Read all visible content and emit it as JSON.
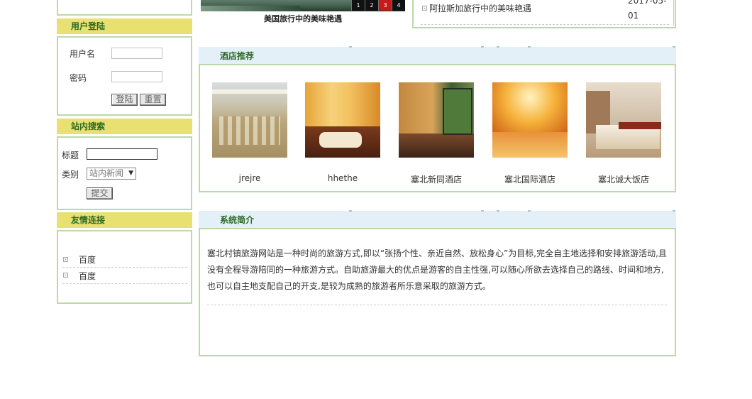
{
  "banner": {
    "caption": "美国旅行中的美味艳遇",
    "pages": [
      "1",
      "2",
      "3",
      "4"
    ],
    "active_page": 3
  },
  "news": {
    "item_title": "阿拉斯加旅行中的美味艳遇",
    "item_date_line1": "2017-05-",
    "item_date_line2": "01"
  },
  "login": {
    "header": "用户登陆",
    "username_label": "用户名",
    "password_label": "密码",
    "login_button": "登陆",
    "reset_button": "重置"
  },
  "search": {
    "header": "站内搜索",
    "title_label": "标题",
    "category_label": "类别",
    "category_selected": "站内新闻",
    "submit_button": "提交"
  },
  "links": {
    "header": "友情连接",
    "items": [
      "百度",
      "百度"
    ]
  },
  "hotels": {
    "header": "酒店推荐",
    "items": [
      {
        "name": "jrejre",
        "img": "hotel-lobby-image"
      },
      {
        "name": "hhethe",
        "img": "hotel-restaurant-image"
      },
      {
        "name": "塞北新同酒店",
        "img": "hotel-dining-room-image"
      },
      {
        "name": "塞北国际酒店",
        "img": "hotel-hallway-image"
      },
      {
        "name": "塞北诚大饭店",
        "img": "hotel-bedroom-image"
      }
    ]
  },
  "about": {
    "header": "系统简介",
    "text": "塞北村镇旅游网站是一种时尚的旅游方式,即以“张扬个性、亲近自然、放松身心”为目标,完全自主地选择和安排旅游活动,且没有全程导游陪同的一种旅游方式。自助旅游最大的优点是游客的自主性强,可以随心所欲去选择自己的路线、时间和地方,也可以自主地支配自己的开支,是较为成熟的旅游者所乐意采取的旅游方式。"
  },
  "colors": {
    "panel_border": "#bcd9a7",
    "yellow_header": "#e8e070",
    "blue_header": "#e3f0f8",
    "header_text": "#2c6a24"
  }
}
